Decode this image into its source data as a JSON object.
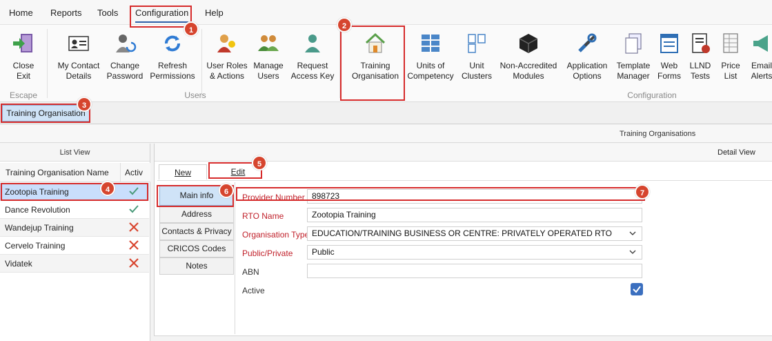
{
  "menubar": {
    "items": [
      "Home",
      "Reports",
      "Tools",
      "Configuration",
      "Help"
    ],
    "active": "Configuration"
  },
  "ribbon": {
    "escape_group": "Escape",
    "users_group": "Users",
    "configuration_group": "Configuration",
    "buttons": {
      "close_exit": "Close\nExit",
      "my_contact_details": "My Contact\nDetails",
      "change_password": "Change\nPassword",
      "refresh_permissions": "Refresh\nPermissions",
      "user_roles_actions": "User Roles\n& Actions",
      "manage_users": "Manage\nUsers",
      "request_access_key": "Request\nAccess Key",
      "training_organisation": "Training\nOrganisation",
      "units_of_competency": "Units of\nCompetency",
      "unit_clusters": "Unit\nClusters",
      "non_accredited_modules": "Non-Accredited\nModules",
      "application_options": "Application\nOptions",
      "template_manager": "Template\nManager",
      "web_forms": "Web\nForms",
      "llnd_tests": "LLND\nTests",
      "price_list": "Price\nList",
      "email_alerts": "Email\nAlerts"
    }
  },
  "doc_tab": "Training Organisation",
  "title_strip": "Training Organisations",
  "list_view": {
    "header": "List View",
    "col_name": "Training Organisation Name",
    "col_active": "Activ",
    "rows": [
      {
        "name": "Zootopia Training",
        "active": true
      },
      {
        "name": "Dance Revolution",
        "active": true
      },
      {
        "name": "Wandejup Training",
        "active": false
      },
      {
        "name": "Cervelo Training",
        "active": false
      },
      {
        "name": "Vidatek",
        "active": false
      }
    ]
  },
  "detail_view": {
    "header": "Detail View",
    "toolbar": {
      "new": "New",
      "edit": "Edit"
    },
    "tabs": [
      "Main info",
      "Address",
      "Contacts & Privacy",
      "CRICOS Codes",
      "Notes"
    ],
    "fields": {
      "provider_number_label": "Provider Number",
      "provider_number": "898723",
      "rto_name_label": "RTO Name",
      "rto_name": "Zootopia Training",
      "org_type_label": "Organisation Type",
      "org_type": "EDUCATION/TRAINING BUSINESS OR CENTRE: PRIVATELY OPERATED RTO",
      "public_private_label": "Public/Private",
      "public_private": "Public",
      "abn_label": "ABN",
      "abn": "",
      "active_label": "Active",
      "active": true
    }
  },
  "callouts": [
    "1",
    "2",
    "3",
    "4",
    "5",
    "6",
    "7"
  ],
  "colors": {
    "accent": "#2f5fa8",
    "required": "#c0202a",
    "highlight": "#d62a2a",
    "badge": "#d6452e",
    "selection": "#c9defc"
  }
}
